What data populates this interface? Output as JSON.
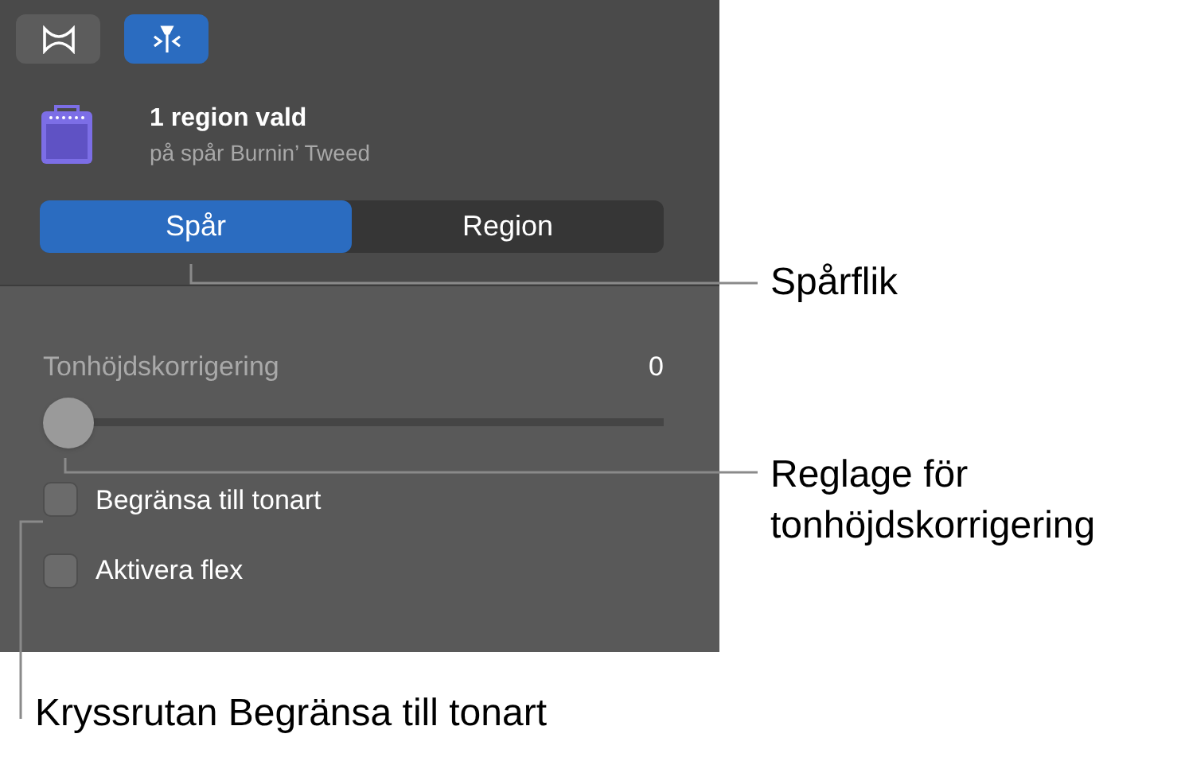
{
  "toolbar": {
    "buttons": [
      {
        "kind": "link",
        "selected": false
      },
      {
        "kind": "pitch",
        "selected": true
      }
    ]
  },
  "header": {
    "title": "1 region vald",
    "subtitle": "på spår Burnin’ Tweed"
  },
  "tabs": [
    {
      "label": "Spår",
      "selected": true
    },
    {
      "label": "Region",
      "selected": false
    }
  ],
  "slider": {
    "label": "Tonhöjdskorrigering",
    "reading": "0",
    "level": 0
  },
  "checkboxes": [
    {
      "label": "Begränsa till tonart",
      "checked": false
    },
    {
      "label": "Aktivera flex",
      "checked": false
    }
  ],
  "callouts": [
    "Spårflik",
    "Reglage för tonhöjdskorrigering",
    "Kryssrutan Begränsa till tonart"
  ]
}
